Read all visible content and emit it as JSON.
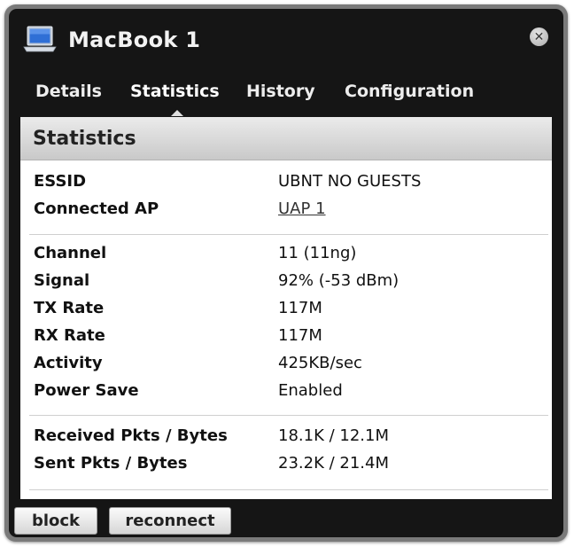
{
  "window": {
    "title": "MacBook 1",
    "icon": "laptop-icon",
    "close_icon": "close-icon",
    "close_glyph": "✕"
  },
  "tabs": [
    {
      "label": "Details",
      "active": false
    },
    {
      "label": "Statistics",
      "active": true
    },
    {
      "label": "History",
      "active": false
    },
    {
      "label": "Configuration",
      "active": false
    }
  ],
  "panel": {
    "header": "Statistics",
    "group1": [
      {
        "label": "ESSID",
        "value": "UBNT NO GUESTS"
      },
      {
        "label": "Connected AP",
        "value": "UAP 1"
      }
    ],
    "group2": [
      {
        "label": "Channel",
        "value": "11 (11ng)"
      },
      {
        "label": "Signal",
        "value": "92% (-53 dBm)"
      },
      {
        "label": "TX Rate",
        "value": "117M"
      },
      {
        "label": "RX Rate",
        "value": "117M"
      },
      {
        "label": "Activity",
        "value": "425KB/sec"
      },
      {
        "label": "Power Save",
        "value": "Enabled"
      }
    ],
    "group3": [
      {
        "label": "Received Pkts / Bytes",
        "value": "18.1K / 12.1M"
      },
      {
        "label": "Sent Pkts / Bytes",
        "value": "23.2K / 21.4M"
      }
    ]
  },
  "actions": {
    "block_label": "block",
    "reconnect_label": "reconnect"
  },
  "colors": {
    "window_bg": "#151515",
    "panel_bg": "#ffffff",
    "header_bg": "#d9d9d9"
  }
}
